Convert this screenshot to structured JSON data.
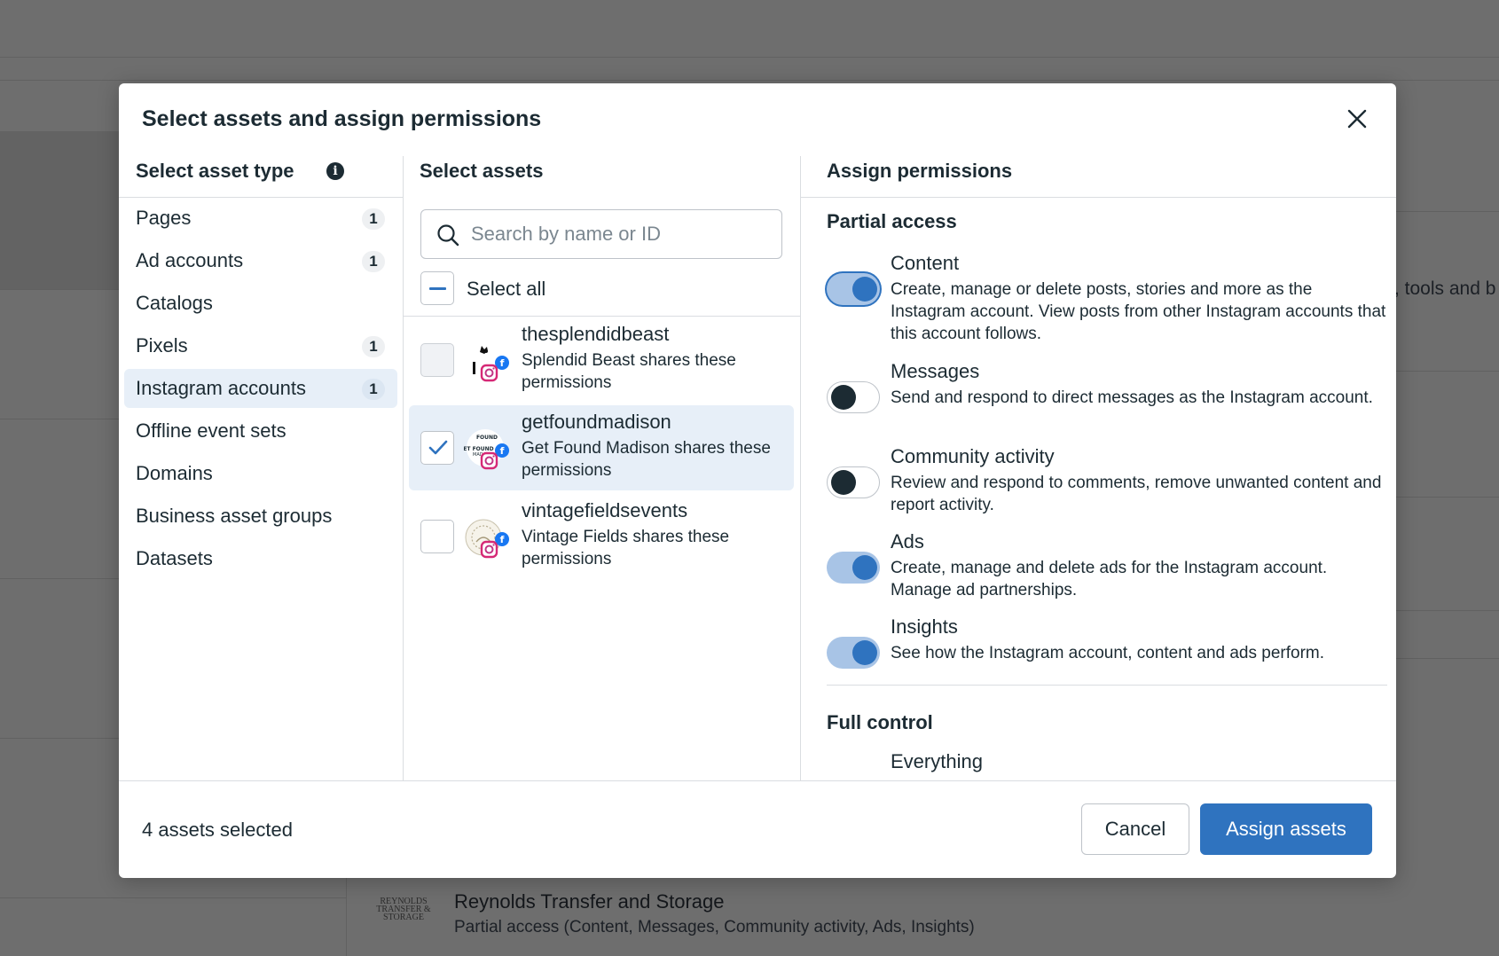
{
  "modal": {
    "title": "Select assets and assign permissions"
  },
  "asset_types": {
    "heading": "Select asset type",
    "items": [
      {
        "label": "Pages",
        "count": "1"
      },
      {
        "label": "Ad accounts",
        "count": "1"
      },
      {
        "label": "Catalogs",
        "count": ""
      },
      {
        "label": "Pixels",
        "count": "1"
      },
      {
        "label": "Instagram accounts",
        "count": "1",
        "active": true
      },
      {
        "label": "Offline event sets",
        "count": ""
      },
      {
        "label": "Domains",
        "count": ""
      },
      {
        "label": "Business asset groups",
        "count": ""
      },
      {
        "label": "Datasets",
        "count": ""
      }
    ]
  },
  "assets": {
    "heading": "Select assets",
    "search_placeholder": "Search by name or ID",
    "select_all_label": "Select all",
    "items": [
      {
        "name": "thesplendidbeast",
        "desc": "Splendid Beast shares these permissions",
        "checked": false
      },
      {
        "name": "getfoundmadison",
        "desc": "Get Found Madison shares these permissions",
        "checked": true
      },
      {
        "name": "vintagefieldsevents",
        "desc": "Vintage Fields shares these permissions",
        "checked": false
      }
    ]
  },
  "permissions": {
    "heading": "Assign permissions",
    "partial_title": "Partial access",
    "partial": [
      {
        "title": "Content",
        "desc": "Create, manage or delete posts, stories and more as the Instagram account. View posts from other Instagram accounts that this account follows.",
        "on": true
      },
      {
        "title": "Messages",
        "desc": "Send and respond to direct messages as the Instagram account.",
        "on": false
      },
      {
        "title": "Community activity",
        "desc": "Review and respond to comments, remove unwanted content and report activity.",
        "on": false
      },
      {
        "title": "Ads",
        "desc": "Create, manage and delete ads for the Instagram account. Manage ad partnerships.",
        "on": true
      },
      {
        "title": "Insights",
        "desc": "See how the Instagram account, content and ads perform.",
        "on": true
      }
    ],
    "full_title": "Full control",
    "full": [
      {
        "title": "Everything"
      }
    ]
  },
  "footer": {
    "selected_count": "4 assets selected",
    "cancel_label": "Cancel",
    "assign_label": "Assign assets"
  },
  "background": {
    "side_text": ", tools and b",
    "row_title": "Reynolds Transfer and Storage",
    "row_subtitle": "Partial access (Content, Messages, Community activity, Ads, Insights)",
    "row_logo_text": "REYNOLDS"
  },
  "colors": {
    "primary": "#2f73bf",
    "selected_bg": "#e7eff8",
    "text": "#1c2b33"
  }
}
